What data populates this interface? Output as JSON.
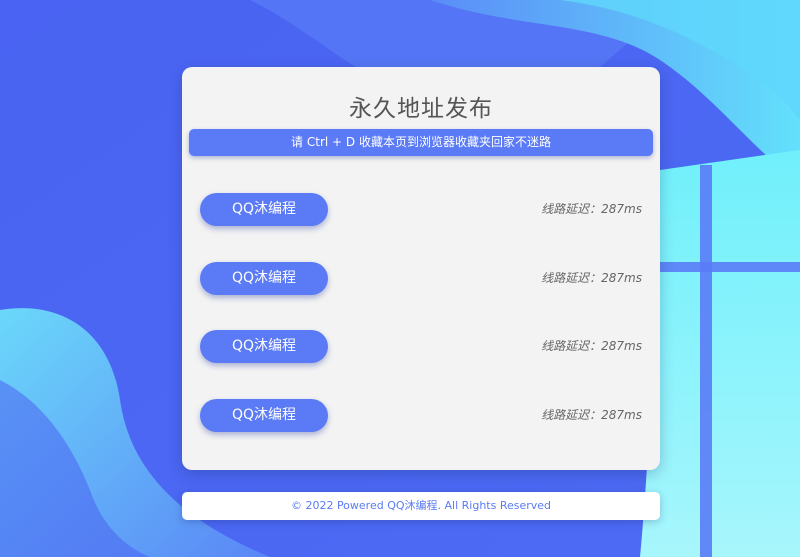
{
  "page": {
    "title": "永久地址发布",
    "notice": "请 Ctrl + D 收藏本页到浏览器收藏夹回家不迷路"
  },
  "lines": [
    {
      "label": "QQ沐编程",
      "latency": "线路延迟：287ms"
    },
    {
      "label": "QQ沐编程",
      "latency": "线路延迟：287ms"
    },
    {
      "label": "QQ沐编程",
      "latency": "线路延迟：287ms"
    },
    {
      "label": "QQ沐编程",
      "latency": "线路延迟：287ms"
    }
  ],
  "footer": {
    "text": "© 2022 Powered QQ沐编程. All Rights Reserved"
  },
  "colors": {
    "accent": "#5b7bf6",
    "background": "#4f6cf5",
    "card": "#f3f3f3"
  }
}
